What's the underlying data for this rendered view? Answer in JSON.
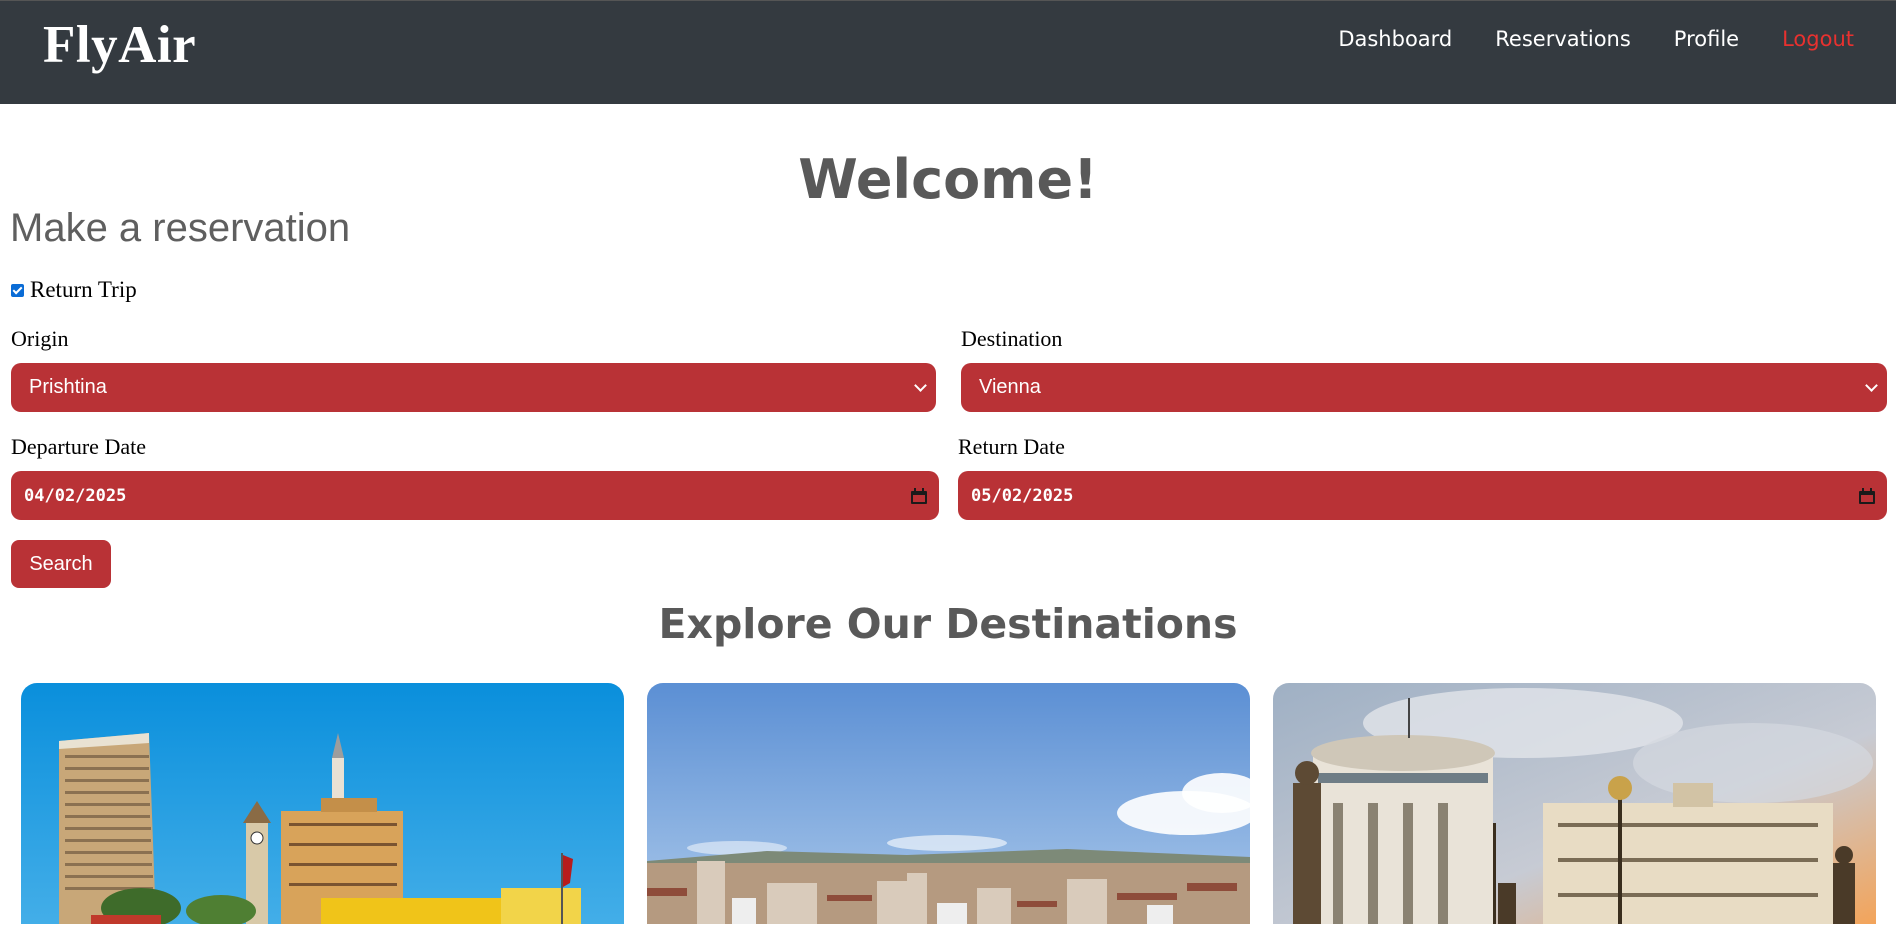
{
  "navbar": {
    "brand": "FlyAir",
    "links": [
      {
        "label": "Dashboard"
      },
      {
        "label": "Reservations"
      },
      {
        "label": "Profile"
      },
      {
        "label": "Logout",
        "color": "#e8312f"
      }
    ]
  },
  "main": {
    "welcome": "Welcome!",
    "reservation_title": "Make a reservation",
    "return_trip": {
      "label": "Return Trip",
      "checked": true
    },
    "origin": {
      "label": "Origin",
      "value": "Prishtina"
    },
    "destination": {
      "label": "Destination",
      "value": "Vienna"
    },
    "departure_date": {
      "label": "Departure Date",
      "value": "04/02/2025"
    },
    "return_date": {
      "label": "Return Date",
      "value": "05/02/2025"
    },
    "search_button": "Search",
    "explore_title": "Explore Our Destinations"
  },
  "colors": {
    "navbar_bg": "#343a40",
    "accent": "#b93236",
    "logout": "#e8312f",
    "heading": "#595959"
  }
}
